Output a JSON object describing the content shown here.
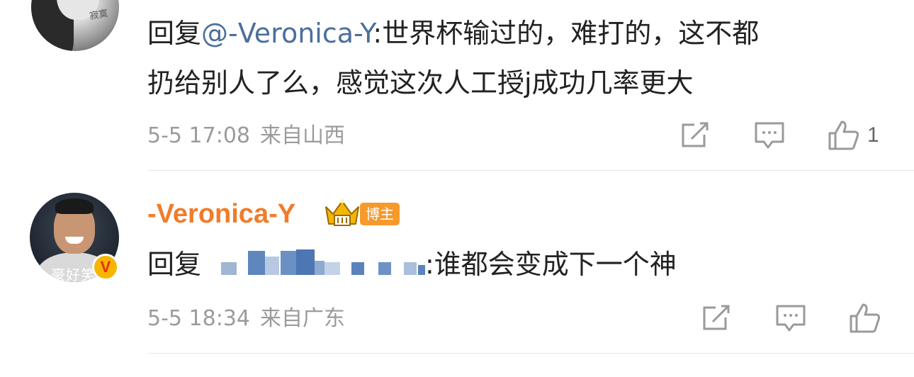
{
  "comments": [
    {
      "avatar_watermark": "寂寞",
      "reply_prefix": "回复",
      "mention": "@-Veronica-Y",
      "line1_rest": ":世界杯输过的，难打的，这不都",
      "line2": "扔给别人了么，感觉这次人工授j成功几率更大",
      "time": "5-5 17:08",
      "location": "来自山西",
      "share_icon": "share-icon",
      "comment_icon": "comment-icon",
      "like_icon": "like-icon",
      "like_count": "1"
    },
    {
      "username": "-Veronica-Y",
      "badge": "博主",
      "avatar_watermark": "豪好笑",
      "verified_badge": "V",
      "reply_prefix": "回复",
      "reply_rest": ":谁都会变成下一个神",
      "time": "5-5 18:34",
      "location": "来自广东",
      "share_icon": "share-icon",
      "comment_icon": "comment-icon",
      "like_icon": "like-icon"
    }
  ],
  "colors": {
    "mention": "#4a6f9c",
    "username": "#f07c2a",
    "badge_bg": "#f59a2b",
    "meta": "#9b9b9b",
    "verified": "#f7b500"
  }
}
